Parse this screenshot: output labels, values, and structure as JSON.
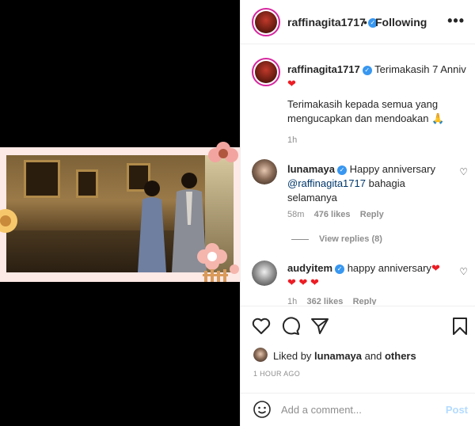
{
  "header": {
    "username": "raffinagita1717",
    "separator": "•",
    "follow_status": "Following",
    "more_label": "•••"
  },
  "caption": {
    "username": "raffinagita1717",
    "text_line1": "Terimakasih 7 Anniv",
    "text_body": "Terimakasih kepada semua yang mengucapkan dan mendoakan",
    "emoji": "🙏",
    "time": "1h"
  },
  "comments": [
    {
      "username": "lunamaya",
      "text": "Happy anniversary",
      "mention": "@raffinagita1717",
      "text_after": "bahagia selamanya",
      "time": "58m",
      "likes": "476 likes",
      "reply": "Reply",
      "view_replies": "View replies (8)"
    },
    {
      "username": "audyitem",
      "text": "happy anniversary",
      "time": "1h",
      "likes": "362 likes",
      "reply": "Reply"
    }
  ],
  "liked_by": {
    "prefix": "Liked by",
    "user": "lunamaya",
    "and": "and",
    "others": "others"
  },
  "timestamp": "1 HOUR AGO",
  "add_comment": {
    "placeholder": "Add a comment...",
    "post_label": "Post"
  },
  "icons": [
    "heart-icon",
    "comment-icon",
    "share-icon",
    "bookmark-icon",
    "emoji-icon",
    "more-icon",
    "verified-badge-icon"
  ],
  "colors": {
    "verified": "#3897f0",
    "link": "#00376b",
    "muted": "#8e8e8e",
    "post": "#b3dbff",
    "heart": "#ed1c24"
  }
}
